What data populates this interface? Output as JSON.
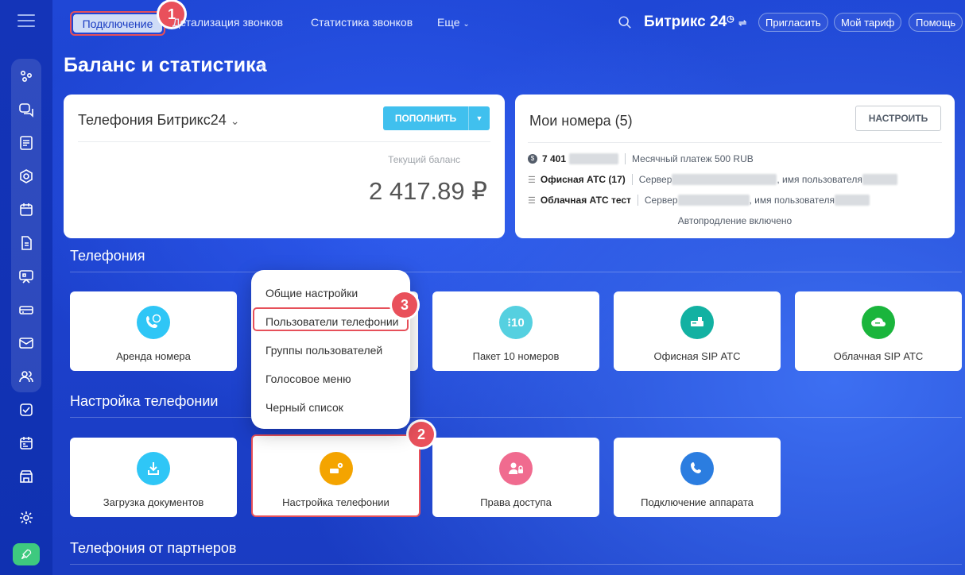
{
  "nav": {
    "connect": "Подключение",
    "details": "Детализация звонков",
    "stats": "Статистика звонков",
    "more": "Еще",
    "brand": "Битрикс 24",
    "invite": "Пригласить",
    "tariff": "Мой тариф",
    "help": "Помощь"
  },
  "badges": {
    "b1": "1",
    "b2": "2",
    "b3": "3"
  },
  "page": {
    "title": "Баланс и статистика"
  },
  "telephony_card": {
    "title": "Телефония Битрикс24",
    "topup": "ПОПОЛНИТЬ",
    "balance_label": "Текущий баланс",
    "balance_value": "2 417.89 ₽"
  },
  "numbers_card": {
    "title": "Мои номера (5)",
    "configure": "НАСТРОИТЬ",
    "row1_number": "7 401",
    "row1_info": "Месячный платеж 500 RUB",
    "row2_name": "Офисная АТС (17)",
    "row2_server": "Сервер",
    "row2_user": ", имя пользователя",
    "row3_name": "Облачная АТС тест",
    "row3_server": "Сервер",
    "row3_user": ", имя пользователя",
    "autorenew": "Автопродление включено"
  },
  "sections": {
    "telephony": "Телефония",
    "settings": "Настройка телефонии",
    "partners": "Телефония от партнеров"
  },
  "tiles_row1": [
    "Аренда номера",
    "Пакет 10 номеров",
    "Офисная SIP АТС",
    "Облачная SIP АТС"
  ],
  "tiles_row2": [
    "Загрузка документов",
    "Настройка телефонии",
    "Права доступа",
    "Подключение аппарата"
  ],
  "popup": [
    "Общие настройки",
    "Пользователи телефонии",
    "Группы пользователей",
    "Голосовое меню",
    "Черный список"
  ],
  "icons": {
    "rent": "coin-phone-icon",
    "package": "dial-10-icon",
    "office": "office-pbx-icon",
    "cloud": "cloud-pbx-icon",
    "docs": "download-doc-icon",
    "settings": "pbx-settings-icon",
    "access": "lock-user-icon",
    "device": "phone-plug-icon"
  },
  "colors": {
    "badge": "#e9505b",
    "topup": "#40c0ee",
    "rent": "#2fc6f6",
    "package": "#55d0e0",
    "office": "#12b1a2",
    "cloud": "#1ab53c",
    "docs": "#2fc6f6",
    "settings": "#f4a400",
    "access": "#f06b8f",
    "device": "#2b7de0"
  }
}
